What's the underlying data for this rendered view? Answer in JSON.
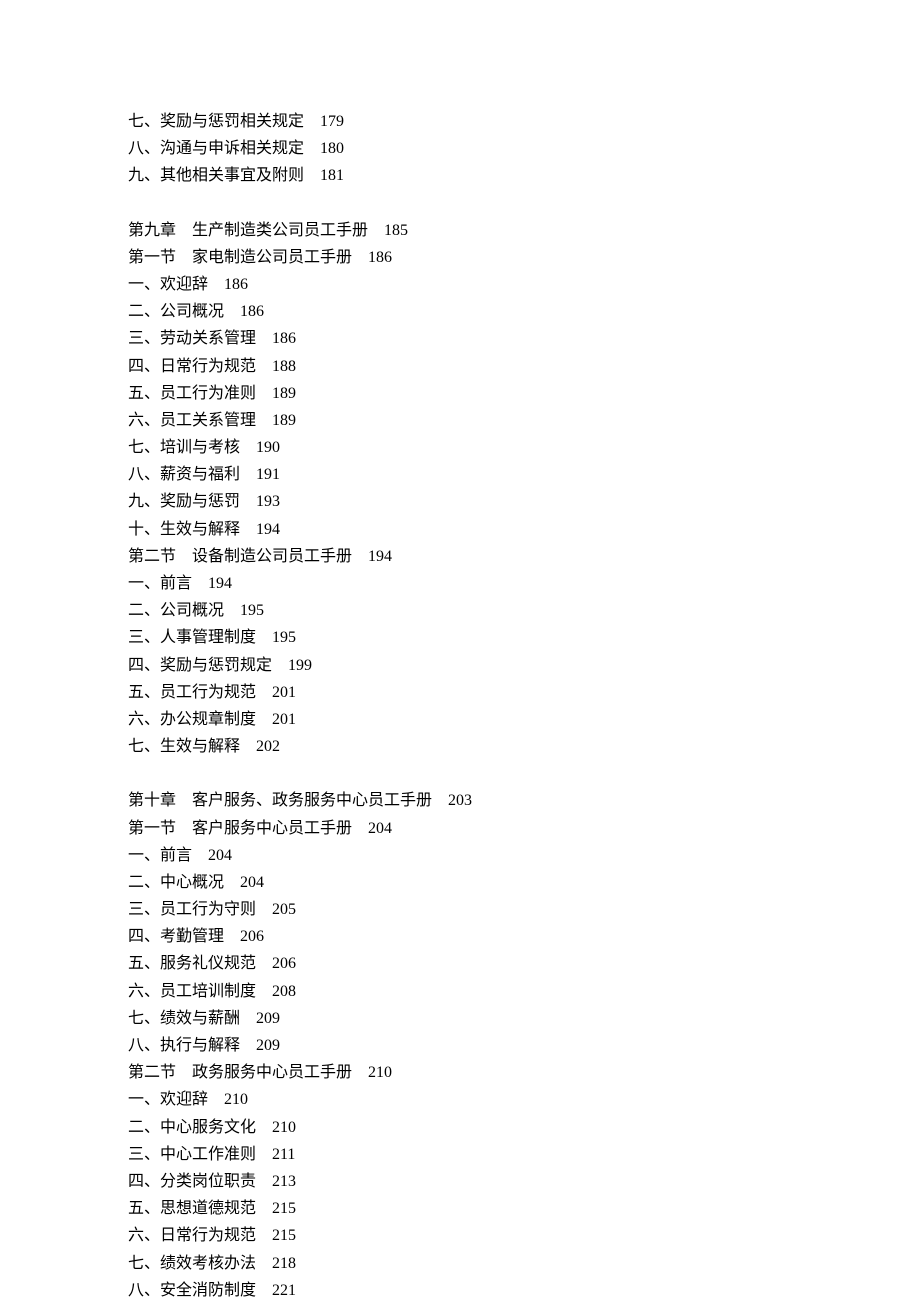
{
  "toc": [
    {
      "type": "entry",
      "title": "七、奖励与惩罚相关规定",
      "page": "179"
    },
    {
      "type": "entry",
      "title": "八、沟通与申诉相关规定",
      "page": "180"
    },
    {
      "type": "entry",
      "title": "九、其他相关事宜及附则",
      "page": "181"
    },
    {
      "type": "gap"
    },
    {
      "type": "entry",
      "title": "第九章　生产制造类公司员工手册",
      "page": "185"
    },
    {
      "type": "entry",
      "title": "第一节　家电制造公司员工手册",
      "page": "186"
    },
    {
      "type": "entry",
      "title": "一、欢迎辞",
      "page": "186"
    },
    {
      "type": "entry",
      "title": "二、公司概况",
      "page": "186"
    },
    {
      "type": "entry",
      "title": "三、劳动关系管理",
      "page": "186"
    },
    {
      "type": "entry",
      "title": "四、日常行为规范",
      "page": "188"
    },
    {
      "type": "entry",
      "title": "五、员工行为准则",
      "page": "189"
    },
    {
      "type": "entry",
      "title": "六、员工关系管理",
      "page": "189"
    },
    {
      "type": "entry",
      "title": "七、培训与考核",
      "page": "190"
    },
    {
      "type": "entry",
      "title": "八、薪资与福利",
      "page": "191"
    },
    {
      "type": "entry",
      "title": "九、奖励与惩罚",
      "page": "193"
    },
    {
      "type": "entry",
      "title": "十、生效与解释",
      "page": "194"
    },
    {
      "type": "entry",
      "title": "第二节　设备制造公司员工手册",
      "page": "194"
    },
    {
      "type": "entry",
      "title": "一、前言",
      "page": "194"
    },
    {
      "type": "entry",
      "title": "二、公司概况",
      "page": "195"
    },
    {
      "type": "entry",
      "title": "三、人事管理制度",
      "page": "195"
    },
    {
      "type": "entry",
      "title": "四、奖励与惩罚规定",
      "page": "199"
    },
    {
      "type": "entry",
      "title": "五、员工行为规范",
      "page": "201"
    },
    {
      "type": "entry",
      "title": "六、办公规章制度",
      "page": "201"
    },
    {
      "type": "entry",
      "title": "七、生效与解释",
      "page": "202"
    },
    {
      "type": "gap"
    },
    {
      "type": "entry",
      "title": "第十章　客户服务、政务服务中心员工手册",
      "page": "203"
    },
    {
      "type": "entry",
      "title": "第一节　客户服务中心员工手册",
      "page": "204"
    },
    {
      "type": "entry",
      "title": "一、前言",
      "page": "204"
    },
    {
      "type": "entry",
      "title": "二、中心概况",
      "page": "204"
    },
    {
      "type": "entry",
      "title": "三、员工行为守则",
      "page": "205"
    },
    {
      "type": "entry",
      "title": "四、考勤管理",
      "page": "206"
    },
    {
      "type": "entry",
      "title": "五、服务礼仪规范",
      "page": "206"
    },
    {
      "type": "entry",
      "title": "六、员工培训制度",
      "page": "208"
    },
    {
      "type": "entry",
      "title": "七、绩效与薪酬",
      "page": "209"
    },
    {
      "type": "entry",
      "title": "八、执行与解释",
      "page": "209"
    },
    {
      "type": "entry",
      "title": "第二节　政务服务中心员工手册",
      "page": "210"
    },
    {
      "type": "entry",
      "title": "一、欢迎辞",
      "page": "210"
    },
    {
      "type": "entry",
      "title": "二、中心服务文化",
      "page": "210"
    },
    {
      "type": "entry",
      "title": "三、中心工作准则",
      "page": "211"
    },
    {
      "type": "entry",
      "title": "四、分类岗位职责",
      "page": "213"
    },
    {
      "type": "entry",
      "title": "五、思想道德规范",
      "page": "215"
    },
    {
      "type": "entry",
      "title": "六、日常行为规范",
      "page": "215"
    },
    {
      "type": "entry",
      "title": "七、绩效考核办法",
      "page": "218"
    },
    {
      "type": "entry",
      "title": "八、安全消防制度",
      "page": "221"
    }
  ]
}
